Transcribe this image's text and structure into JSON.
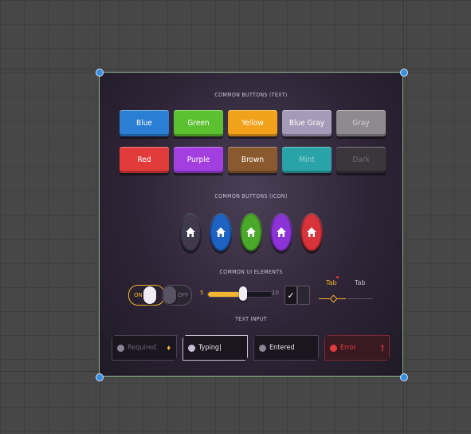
{
  "sections": {
    "buttons_text": "COMMON BUTTONS (TEXT)",
    "buttons_icon": "COMMON BUTTONS (ICON)",
    "ui_elements": "COMMON UI ELEMENTS",
    "text_input": "TEXT INPUT"
  },
  "text_buttons": [
    {
      "label": "Blue",
      "color": "#2a7fd4"
    },
    {
      "label": "Green",
      "color": "#5cc130"
    },
    {
      "label": "Yellow",
      "color": "#f2a11a"
    },
    {
      "label": "Blue Gray",
      "color": "#a59ab8"
    },
    {
      "label": "Gray",
      "color": "#8e8a8e"
    },
    {
      "label": "Red",
      "color": "#e23b3b"
    },
    {
      "label": "Purple",
      "color": "#a33fe0"
    },
    {
      "label": "Brown",
      "color": "#8a5a2e"
    },
    {
      "label": "Mint",
      "color": "#2aa3a8"
    },
    {
      "label": "Dark",
      "color": "#3a363c"
    }
  ],
  "icon_buttons": [
    {
      "icon": "home-icon",
      "color": "#3f3a4c"
    },
    {
      "icon": "home-icon",
      "color": "#1e63c4"
    },
    {
      "icon": "home-icon",
      "color": "#4aa82a"
    },
    {
      "icon": "home-icon",
      "color": "#8b33d6"
    },
    {
      "icon": "home-icon",
      "color": "#d8323a"
    }
  ],
  "ui": {
    "toggle_on_label": "ON",
    "toggle_off_label": "OFF",
    "slider_min": "5",
    "slider_max": "10",
    "slider_value_fraction": 0.55,
    "checkbox_checked": true,
    "tab_active": "Tab",
    "tab_inactive": "Tab"
  },
  "inputs": [
    {
      "placeholder": "Required",
      "value": "",
      "state": "required"
    },
    {
      "placeholder": "",
      "value": "Typing|",
      "state": "typing"
    },
    {
      "placeholder": "",
      "value": "Entered",
      "state": "entered"
    },
    {
      "placeholder": "",
      "value": "Error",
      "state": "error"
    }
  ],
  "colors": {
    "accent_yellow": "#f2b431",
    "error_red": "#e23b3b",
    "selection_outline": "#8fb88f",
    "handle_blue": "#3b8de0"
  }
}
